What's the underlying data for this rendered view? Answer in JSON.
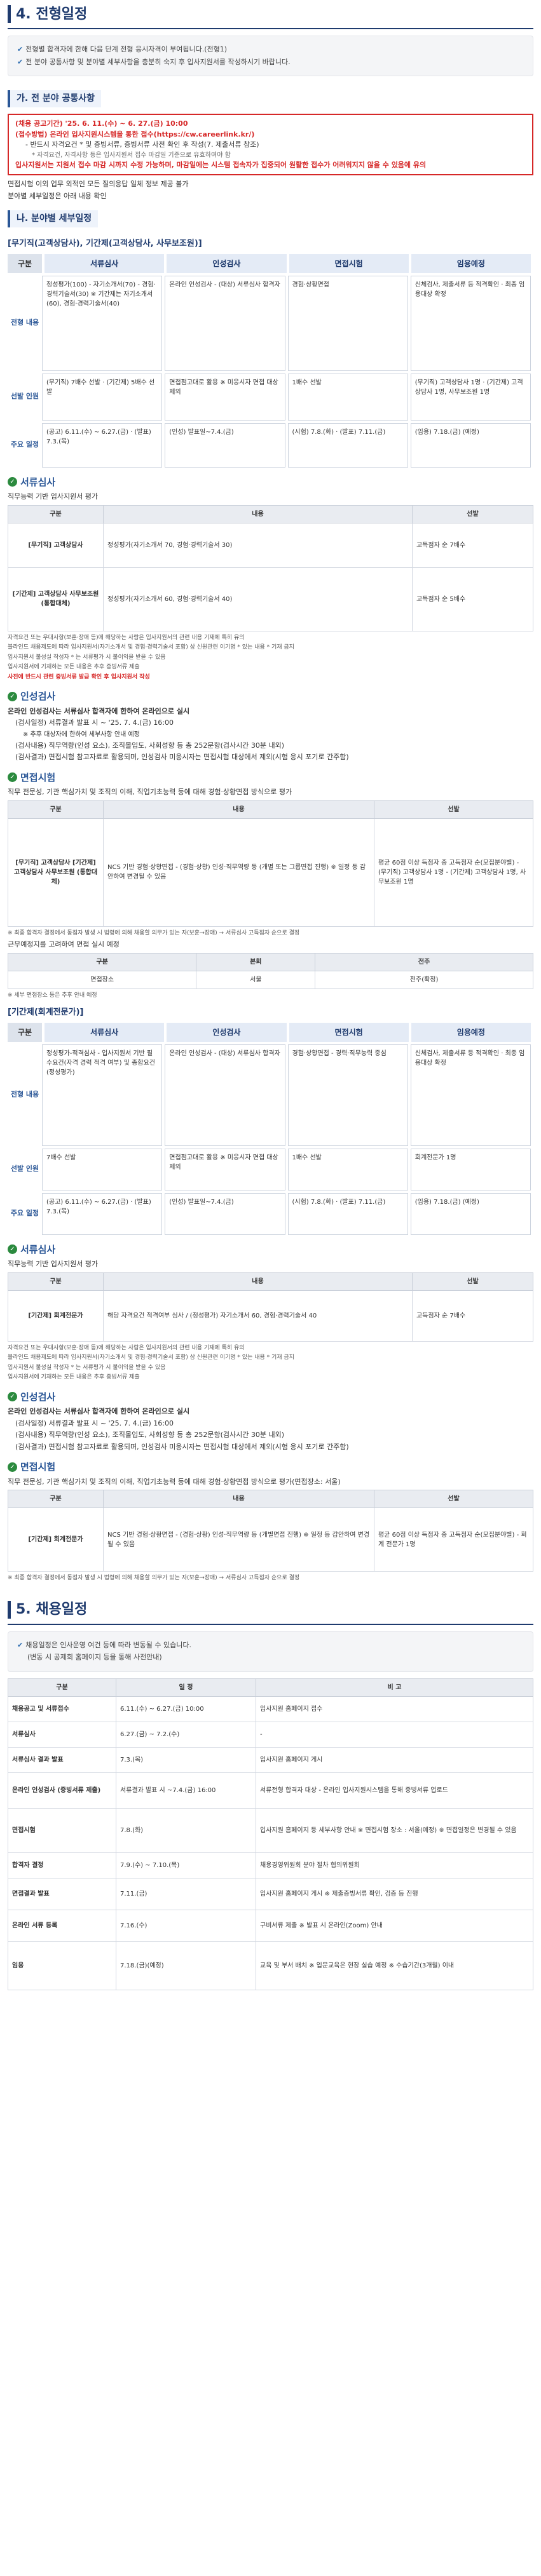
{
  "section4": {
    "title": "4. 전형일정",
    "notice": [
      "전형별 합격자에 한해 다음 단계 전형 응시자격이 부여됩니다.(전형1)",
      "전 분야 공통사항 및 분야별 세부사항을 충분히 숙지 후 입사지원서를 작성하시기 바랍니다."
    ]
  },
  "common": {
    "subtitle": "가. 전 분야 공통사항",
    "redbox": [
      "(채용 공고기간) '25. 6. 11.(수) ~ 6. 27.(금) 10:00",
      "(접수방법) 온라인 입사지원시스템을 통한 접수(https://cw.careerlink.kr/)",
      "- 반드시 자격요건 * 및 증빙서류, 증빙서류 사전 확인 후 작성(7. 제출서류 참조)",
      "* 자격요건, 자격사항 등은 입사지원서 접수 마감일 기준으로 유효하여야 함",
      "입사지원서는 지원서 접수 마감 시까지 수정 가능하며, 마감일에는 시스템 접속자가 집중되어 원활한 접수가 어려워지지 않을 수 있음에 유의"
    ],
    "after": [
      "면접시험 이외 업무 외적인 모든 질의응답 일체 정보 제공 불가",
      "분야별 세부일정은 아래 내용 확인"
    ]
  },
  "detail": {
    "subtitle": "나. 분야별 세부일정",
    "group1": "[무기직(고객상담사), 기간제(고객상담사, 사무보조원)]",
    "stages": [
      "서류심사",
      "인성검사",
      "면접시험",
      "임용예정"
    ],
    "labels": {
      "content": "전형 내용",
      "selection": "선발 인원",
      "schedule": "주요 일정",
      "stage": "구분"
    },
    "content1": [
      "정성평가(100) - 자기소개서(70) - 경험·경력기술서(30) ※ 기간제는 자기소개서(60), 경험·경력기술서(40)",
      "온라인 인성검사 - (대상) 서류심사 합격자",
      "경험·상황면접",
      "신체검사, 제출서류 등 적격확인 · 최종 임용대상 확정"
    ],
    "select1": [
      "(무기직) 7배수 선발 · (기간제) 5배수 선발",
      "면접점고대로 활용 ※ 미응시자 면접 대상 제외",
      "1배수 선발",
      "(무기직) 고객상담사 1명 · (기간제) 고객상담사 1명, 사무보조원 1명"
    ],
    "sched1": [
      "(공고) 6.11.(수) ~ 6.27.(금) · (발표) 7.3.(목)",
      "(인성) 발표일~7.4.(금)",
      "(시험) 7.8.(화) · (발표) 7.11.(금)",
      "(임용) 7.18.(금) (예정)"
    ]
  },
  "doc1": {
    "heading": "서류심사",
    "intro": "직무능력 기반 입사지원서 평가",
    "cols": [
      "구분",
      "내용",
      "선발"
    ],
    "rows": [
      [
        "[무기직] 고객상담사",
        "정성평가(자기소개서 70, 경험·경력기술서 30)",
        "고득점자 순 7배수"
      ],
      [
        "[기간제] 고객상담사 사무보조원 (통합대체)",
        "정성평가(자기소개서 60, 경험·경력기술서 40)",
        "고득점자 순 5배수"
      ]
    ],
    "notes": [
      "자격요건 또는 우대사항(보훈·장애 등)에 해당하는 사람은 입사지원서의 관련 내용 기재에 특히 유의",
      "블라인드 채용제도에 따라 입사지원서(자기소개서 및 경험·경력기술서 포함) 상 신원관련 이기명 * 있는 내용 * 기재 금지",
      "입사지원서 불성실 작성자 * 는 서류평가 시 불이익을 받을 수 있음",
      "입사지원서에 기재하는 모든 내용은 추후 증빙서류 제출",
      "사전에 반드시 관련 증빙서류 발급 확인 후 입사지원서 작성"
    ]
  },
  "personality1": {
    "heading": "인성검사",
    "lines": [
      "온라인 인성검사는 서류심사 합격자에 한하여 온라인으로 실시",
      "(검사일정) 서류결과 발표 시 ~ '25. 7. 4.(금) 16:00",
      "※ 추후 대상자에 한하여 세부사항 안내 예정",
      "(검사내용) 직무역량(인성 요소), 조직몰입도, 사회성향 등 총 252문항(검사시간 30분 내외)",
      "(검사결과) 면접시험 참고자료로 활용되며, 인성검사 미응시자는 면접시험 대상에서 제외(시험 응시 포기로 간주함)"
    ]
  },
  "interview1": {
    "heading": "면접시험",
    "intro": "직무 전문성, 기관 핵심가치 및 조직의 이해, 직업기초능력 등에 대해 경험·상황면접 방식으로 평가",
    "cols": [
      "구분",
      "내용",
      "선발"
    ],
    "target": "[무기직] 고객상담사 [기간제] 고객상담사 사무보조원 (통합대체)",
    "content": "NCS 기반 경험·상황면접 - (경험·상황) 인성·직무역량 등 (개별 또는 그룹면접 진행) ※ 일정 등 감안하여 변경될 수 있음",
    "select": "평균 60점 이상 득점자 중 고득점자 순(모집분야별) - (무기직) 고객상담사 1명 - (기간제) 고객상담사 1명, 사무보조원 1명",
    "note": "※ 최종 합격자 결정에서 동점자 발생 시 법령에 의해 채용할 의무가 있는 자(보훈→장애) → 서류심사 고득점자 순으로 결정",
    "loc_intro": "근무예정지를 고려하여 면접 실시 예정",
    "loc_cols": [
      "구분",
      "본회",
      "전주"
    ],
    "loc_row": [
      "면접장소",
      "서울",
      "전주(확정)"
    ],
    "loc_note": "※ 세부 면접장소 등은 추후 안내 예정"
  },
  "group2": {
    "title": "[기간제(회계전문가)]",
    "content": [
      "정성평가-적격심사 - 입사지원서 기반 필수요건(자격 경력 적격 여부) 및 종합요건 (정성평가)",
      "온라인 인성검사 - (대상) 서류심사 합격자",
      "경험·상황면접 - 경력·직무능력 중심",
      "신체검사, 제출서류 등 적격확인 · 최종 임용대상 확정"
    ],
    "select": [
      "7배수 선발",
      "면접점고대로 활용 ※ 미응시자 면접 대상 제외",
      "1배수 선발",
      "회계전문가 1명"
    ],
    "sched": [
      "(공고) 6.11.(수) ~ 6.27.(금) · (발표) 7.3.(목)",
      "(인성) 발표일~7.4.(금)",
      "(시험) 7.8.(화) · (발표) 7.11.(금)",
      "(임용) 7.18.(금) (예정)"
    ]
  },
  "doc2": {
    "heading": "서류심사",
    "intro": "직무능력 기반 입사지원서 평가",
    "cols": [
      "구분",
      "내용",
      "선발"
    ],
    "row": [
      "[기간제] 회계전문가",
      "해당 자격요건 적격여부 심사 / (정성평가) 자기소개서 60, 경험·경력기술서 40",
      "고득점자 순 7배수"
    ],
    "notes": [
      "자격요건 또는 우대사항(보훈·장애 등)에 해당하는 사람은 입사지원서의 관련 내용 기재에 특히 유의",
      "블라인드 채용제도에 따라 입사지원서(자기소개서 및 경험·경력기술서 포함) 상 신원관련 이기명 * 있는 내용 * 기재 금지",
      "입사지원서 불성실 작성자 * 는 서류평가 시 불이익을 받을 수 있음",
      "입사지원서에 기재하는 모든 내용은 추후 증빙서류 제출"
    ]
  },
  "personality2": {
    "heading": "인성검사",
    "lines": [
      "온라인 인성검사는 서류심사 합격자에 한하여 온라인으로 실시",
      "(검사일정) 서류결과 발표 시 ~ '25. 7. 4.(금) 16:00",
      "(검사내용) 직무역량(인성 요소), 조직몰입도, 사회성향 등 총 252문항(검사시간 30분 내외)",
      "(검사결과) 면접시험 참고자료로 활용되며, 인성검사 미응시자는 면접시험 대상에서 제외(시험 응시 포기로 간주함)"
    ]
  },
  "interview2": {
    "heading": "면접시험",
    "intro": "직무 전문성, 기관 핵심가치 및 조직의 이해, 직업기초능력 등에 대해 경험·상황면접 방식으로 평가(면접장소: 서울)",
    "cols": [
      "구분",
      "내용",
      "선발"
    ],
    "row": [
      "[기간제] 회계전문가",
      "NCS 기반 경험·상황면접 - (경험·상황) 인성·직무역량 등 (개별면접 진행) ※ 일정 등 감안하여 변경될 수 있음",
      "평균 60점 이상 득점자 중 고득점자 순(모집분야별) - 회계 전문가 1명"
    ],
    "note": "※ 최종 합격자 결정에서 동점자 발생 시 법령에 의해 채용할 의무가 있는 자(보훈→장애) → 서류심사 고득점자 순으로 결정"
  },
  "section5": {
    "title": "5. 채용일정",
    "notice": [
      "채용일정은 인사운영 여건 등에 따라 변동될 수 있습니다.",
      "(변동 시 공제회 홈페이지 등을 통해 사전안내)"
    ],
    "cols": [
      "구분",
      "일 정",
      "비 고"
    ],
    "rows": [
      [
        "채용공고 및 서류접수",
        "6.11.(수) ~ 6.27.(금) 10:00",
        "입사지원 홈페이지 접수"
      ],
      [
        "서류심사",
        "6.27.(금) ~ 7.2.(수)",
        "-"
      ],
      [
        "서류심사 결과 발표",
        "7.3.(목)",
        "입사지원 홈페이지 게시"
      ],
      [
        "온라인 인성검사 (증빙서류 제출)",
        "서류결과 발표 시 ~7.4.(금) 16:00",
        "서류전형 합격자 대상 - 온라인 입사지원시스템을 통해 증빙서류 업로드"
      ],
      [
        "면접시험",
        "7.8.(화)",
        "입사지원 홈페이지 등 세부사항 안내 ※ 면접시험 장소 : 서울(예정) ※ 면접일정은 변경될 수 있음"
      ],
      [
        "합격자 결정",
        "7.9.(수) ~ 7.10.(목)",
        "채용경영위원회 분야 절차 협의위원회"
      ],
      [
        "면접결과 발표",
        "7.11.(금)",
        "입사지원 홈페이지 게시 ※ 제출증빙서류 확인, 검증 등 진행"
      ],
      [
        "온라인 서류 등록",
        "7.16.(수)",
        "구비서류 제출 ※ 발표 시 온라인(Zoom) 안내"
      ],
      [
        "임용",
        "7.18.(금)(예정)",
        "교육 및 부서 배치 ※ 입문교육은 현장 실습 예정 ※ 수습기간(3개월) 이내"
      ]
    ]
  }
}
